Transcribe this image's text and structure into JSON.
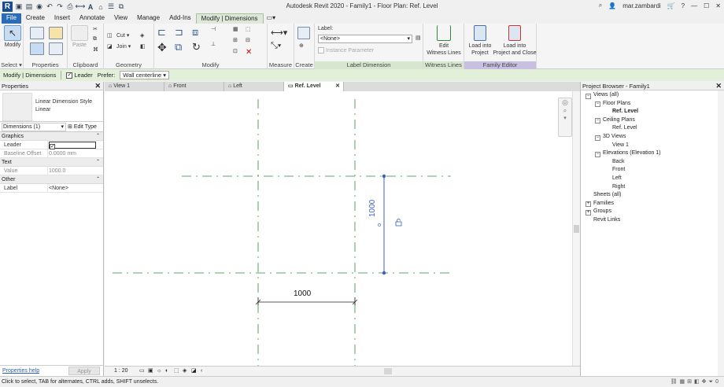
{
  "window": {
    "title": "Autodesk Revit 2020 - Family1 - Floor Plan: Ref. Level",
    "user": "mar.zambardi"
  },
  "ribbon_tabs": [
    "File",
    "Create",
    "Insert",
    "Annotate",
    "View",
    "Manage",
    "Add-Ins",
    "Modify | Dimensions"
  ],
  "ribbon": {
    "modify": "Modify",
    "paste": "Paste",
    "cut": "Cut",
    "join": "Join",
    "label_caption": "Label:",
    "label_value": "<None>",
    "instance_parameter": "Instance Parameter",
    "edit_witness": "Edit\nWitness Lines",
    "load_project": "Load into\nProject",
    "load_close": "Load into\nProject and Close",
    "panels": {
      "select": "Select",
      "properties": "Properties",
      "clipboard": "Clipboard",
      "geometry": "Geometry",
      "modify": "Modify",
      "measure": "Measure",
      "create": "Create",
      "label_dimension": "Label Dimension",
      "witness_lines": "Witness Lines",
      "family_editor": "Family Editor"
    }
  },
  "options_bar": {
    "context": "Modify | Dimensions",
    "leader_label": "Leader",
    "prefer_label": "Prefer:",
    "prefer_value": "Wall centerline"
  },
  "properties": {
    "title": "Properties",
    "type_family": "Linear Dimension Style",
    "type_name": "Linear",
    "selector": "Dimensions (1)",
    "edit_type": "Edit Type",
    "groups": [
      {
        "name": "Graphics",
        "rows": [
          {
            "k": "Leader",
            "v": ""
          },
          {
            "k": "Baseline Offset",
            "v": "0.0000 mm"
          }
        ]
      },
      {
        "name": "Text",
        "rows": [
          {
            "k": "Value",
            "v": "1000.0"
          }
        ]
      },
      {
        "name": "Other",
        "rows": [
          {
            "k": "Label",
            "v": "<None>"
          }
        ]
      }
    ],
    "help": "Properties help",
    "apply": "Apply"
  },
  "view_tabs": [
    "View 1",
    "Front",
    "Left",
    "Ref. Level"
  ],
  "canvas": {
    "horizontal_dimension": "1000",
    "vertical_dimension": "1000"
  },
  "view_control_bar": {
    "scale": "1 : 20"
  },
  "project_browser": {
    "title": "Project Browser - Family1",
    "items": [
      {
        "label": "Views (all)",
        "level": 0
      },
      {
        "label": "Floor Plans",
        "level": 1
      },
      {
        "label": "Ref. Level",
        "level": 2,
        "bold": true
      },
      {
        "label": "Ceiling Plans",
        "level": 1
      },
      {
        "label": "Ref. Level",
        "level": 2
      },
      {
        "label": "3D Views",
        "level": 1
      },
      {
        "label": "View 1",
        "level": 2
      },
      {
        "label": "Elevations (Elevation 1)",
        "level": 1
      },
      {
        "label": "Back",
        "level": 2
      },
      {
        "label": "Front",
        "level": 2
      },
      {
        "label": "Left",
        "level": 2
      },
      {
        "label": "Right",
        "level": 2
      },
      {
        "label": "Sheets (all)",
        "level": 0
      },
      {
        "label": "Families",
        "level": 0
      },
      {
        "label": "Groups",
        "level": 0
      },
      {
        "label": "Revit Links",
        "level": 0
      }
    ]
  },
  "status_bar": {
    "message": "Click to select, TAB for alternates, CTRL adds, SHIFT unselects.",
    "filter_count": "0"
  },
  "colors": {
    "accent": "#2b6cb8",
    "context_tab": "#dde9d8",
    "ref_plane": "#2e8b3c",
    "dimension_selected": "#3a5fbf"
  }
}
